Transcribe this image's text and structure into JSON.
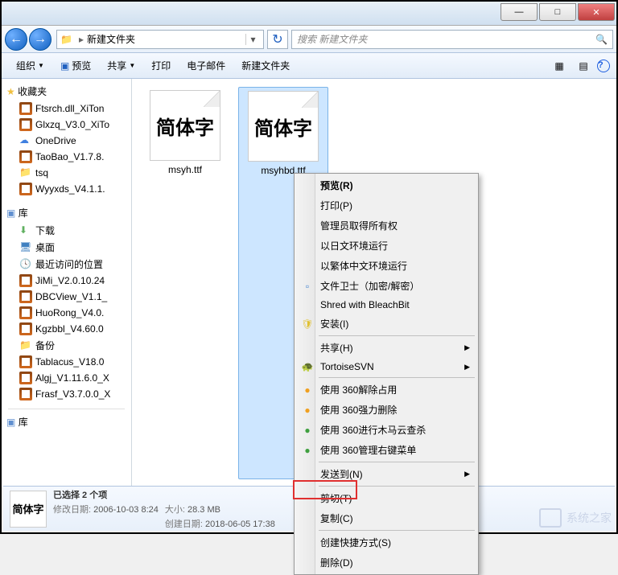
{
  "titlebar": {
    "min": "—",
    "max": "□",
    "close": "✕"
  },
  "nav": {
    "back": "←",
    "fwd": "→",
    "breadcrumb": "新建文件夹",
    "refresh": "↻",
    "search_placeholder": "搜索 新建文件夹",
    "search_icon": "🔍"
  },
  "toolbar": {
    "organize": "组织",
    "preview": "预览",
    "share": "共享",
    "print": "打印",
    "email": "电子邮件",
    "newfolder": "新建文件夹",
    "view_icon": "▦",
    "help_icon": "?"
  },
  "sidebar": {
    "favorites": "收藏夹",
    "items1": [
      {
        "label": "Ftsrch.dll_XiTon",
        "icon": "rar"
      },
      {
        "label": "Glxzq_V3.0_XiTo",
        "icon": "rar"
      },
      {
        "label": "OneDrive",
        "icon": "cloud"
      },
      {
        "label": "TaoBao_V1.7.8.",
        "icon": "rar"
      },
      {
        "label": "tsq",
        "icon": "folder"
      },
      {
        "label": "Wyyxds_V4.1.1.",
        "icon": "rar"
      }
    ],
    "libraries": "库",
    "items2": [
      {
        "label": "下载",
        "icon": "down"
      },
      {
        "label": "桌面",
        "icon": "desk"
      },
      {
        "label": "最近访问的位置",
        "icon": "clock"
      },
      {
        "label": "JiMi_V2.0.10.24",
        "icon": "rar"
      },
      {
        "label": "DBCView_V1.1_",
        "icon": "rar"
      },
      {
        "label": "HuoRong_V4.0.",
        "icon": "rar"
      },
      {
        "label": "Kgzbbl_V4.60.0",
        "icon": "rar"
      },
      {
        "label": "备份",
        "icon": "folder"
      },
      {
        "label": "Tablacus_V18.0",
        "icon": "rar"
      },
      {
        "label": "Algj_V1.11.6.0_X",
        "icon": "rar"
      },
      {
        "label": "Frasf_V3.7.0.0_X",
        "icon": "rar"
      }
    ],
    "libraries2": "库"
  },
  "files": [
    {
      "thumb": "简体字",
      "name": "msyh.ttf"
    },
    {
      "thumb": "简体字",
      "name": "msyhbd.ttf"
    }
  ],
  "status": {
    "thumb": "简体字",
    "selection": "已选择 2 个项",
    "mod_k": "修改日期:",
    "mod_v": "2006-10-03 8:24",
    "size_k": "大小:",
    "size_v": "28.3 MB",
    "create_k": "创建日期:",
    "create_v": "2018-06-05 17:38"
  },
  "context": [
    {
      "label": "预览(R)",
      "bold": true
    },
    {
      "label": "打印(P)"
    },
    {
      "label": "管理员取得所有权"
    },
    {
      "label": "以日文环境运行"
    },
    {
      "label": "以繁体中文环境运行"
    },
    {
      "label": "文件卫士（加密/解密）",
      "icon": "page"
    },
    {
      "label": "Shred with BleachBit"
    },
    {
      "label": "安装(I)",
      "icon": "shield"
    },
    {
      "sep": true
    },
    {
      "label": "共享(H)",
      "arrow": true
    },
    {
      "label": "TortoiseSVN",
      "icon": "tortoise",
      "arrow": true
    },
    {
      "sep": true
    },
    {
      "label": "使用 360解除占用",
      "icon": "g360o"
    },
    {
      "label": "使用 360强力删除",
      "icon": "g360o"
    },
    {
      "label": "使用 360进行木马云查杀",
      "icon": "g360"
    },
    {
      "label": "使用 360管理右键菜单",
      "icon": "g360"
    },
    {
      "sep": true
    },
    {
      "label": "发送到(N)",
      "arrow": true
    },
    {
      "sep": true
    },
    {
      "label": "剪切(T)"
    },
    {
      "label": "复制(C)"
    },
    {
      "sep": true
    },
    {
      "label": "创建快捷方式(S)"
    },
    {
      "label": "删除(D)"
    }
  ],
  "watermark": "系统之家"
}
